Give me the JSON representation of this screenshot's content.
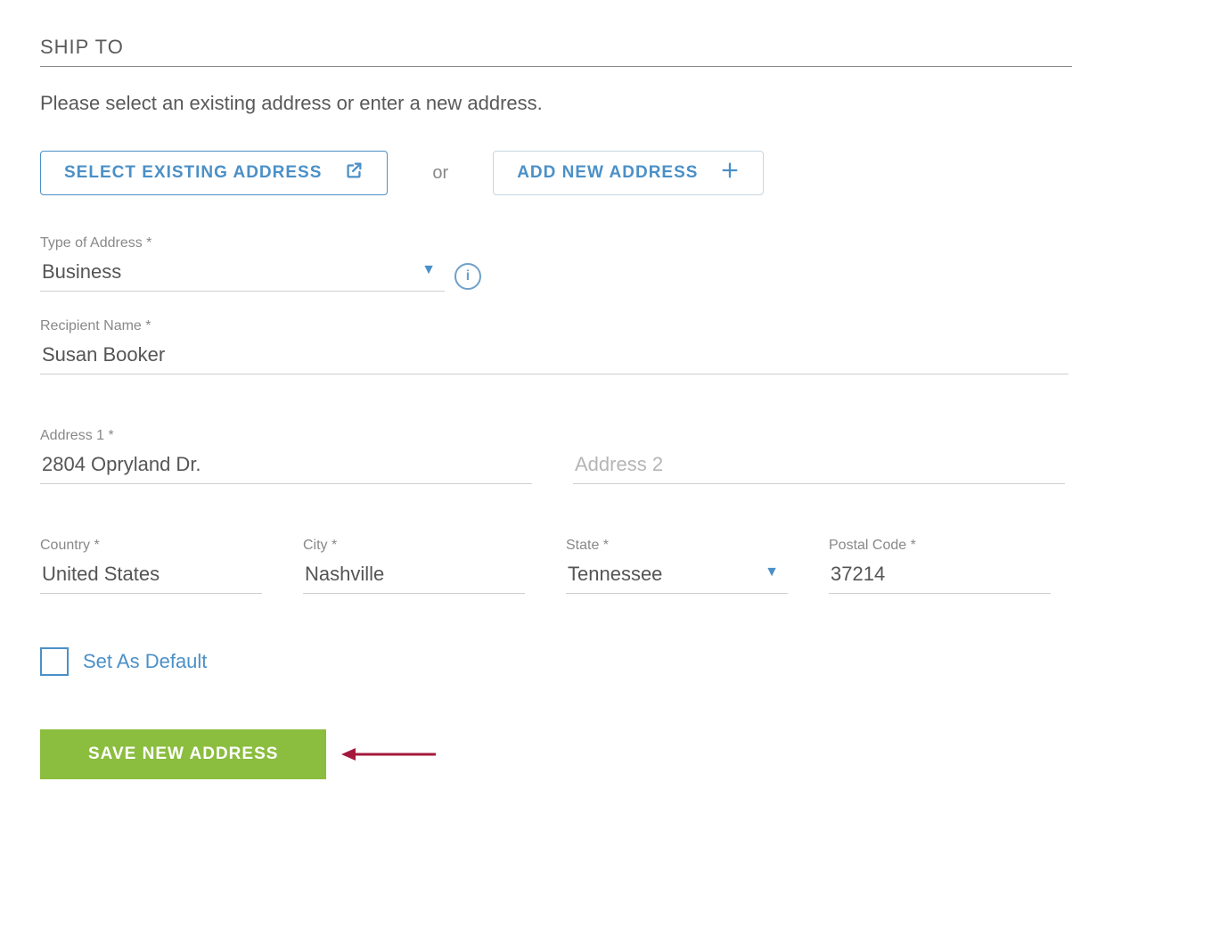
{
  "section": {
    "title": "SHIP TO"
  },
  "instruction": "Please select an existing address or enter a new address.",
  "buttons": {
    "select_existing": "SELECT EXISTING ADDRESS",
    "or": "or",
    "add_new": "ADD NEW ADDRESS"
  },
  "fields": {
    "type_of_address": {
      "label": "Type of Address *",
      "value": "Business"
    },
    "recipient_name": {
      "label": "Recipient Name *",
      "value": "Susan Booker"
    },
    "address1": {
      "label": "Address 1 *",
      "value": "2804 Opryland Dr."
    },
    "address2": {
      "placeholder": "Address 2",
      "value": ""
    },
    "country": {
      "label": "Country *",
      "value": "United States"
    },
    "city": {
      "label": "City *",
      "value": "Nashville"
    },
    "state": {
      "label": "State *",
      "value": "Tennessee"
    },
    "postal": {
      "label": "Postal Code *",
      "value": "37214"
    }
  },
  "set_default_label": "Set As Default",
  "save_button": "SAVE NEW ADDRESS",
  "icons": {
    "external": "external-link-icon",
    "plus": "plus-icon",
    "info": "i",
    "caret": "▼"
  },
  "colors": {
    "accent_blue": "#4b90c7",
    "accent_green": "#8bbd3e",
    "annotation_red": "#a5183c"
  }
}
